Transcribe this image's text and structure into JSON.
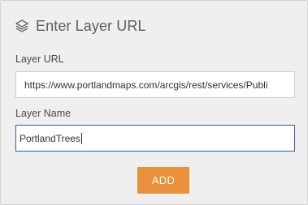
{
  "header": {
    "icon": "layers-icon",
    "title": "Enter Layer URL"
  },
  "form": {
    "url_label": "Layer URL",
    "url_value": "https://www.portlandmaps.com/arcgis/rest/services/Publi",
    "name_label": "Layer Name",
    "name_value": "PortlandTrees",
    "add_label": "ADD"
  },
  "colors": {
    "panel_bg": "#efefef",
    "button_bg": "#e8913a",
    "focus_border": "#2f5c9b",
    "title_text": "#5c5c5c"
  }
}
